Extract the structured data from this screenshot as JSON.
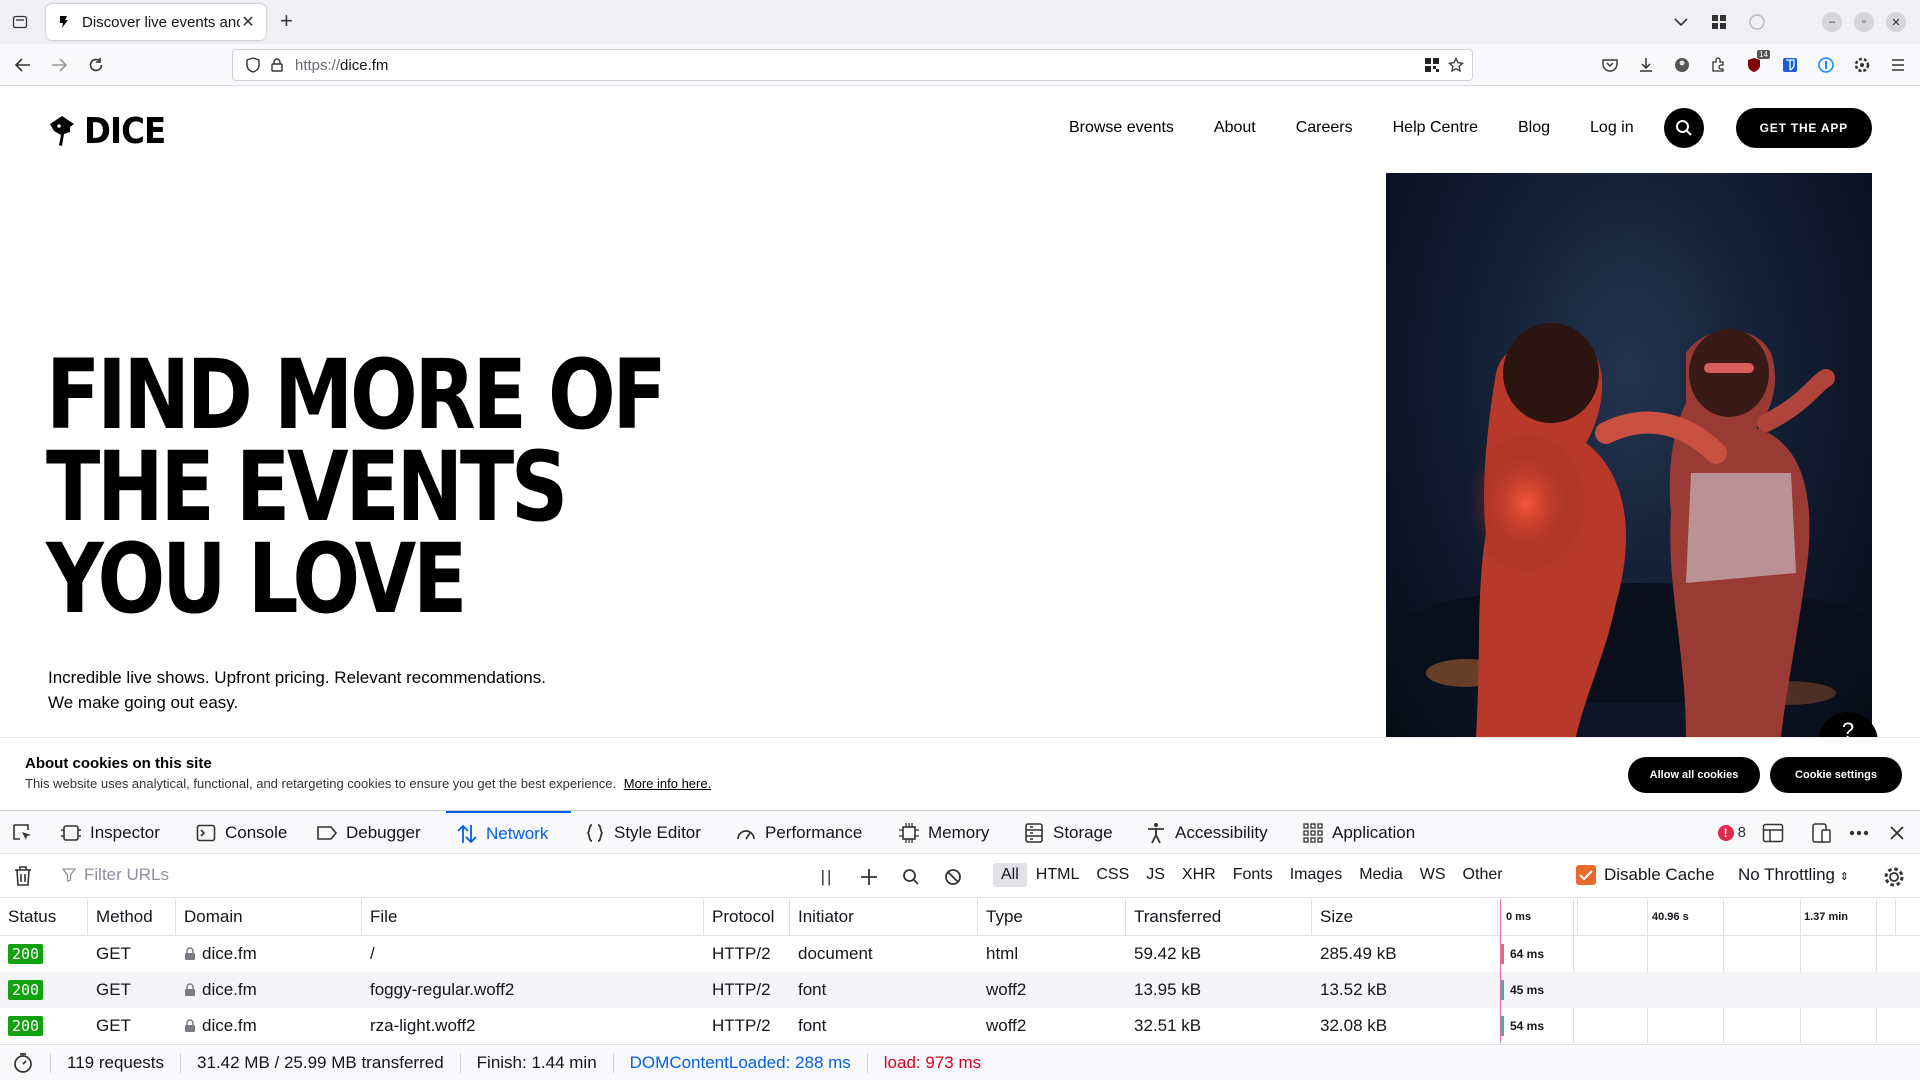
{
  "browser": {
    "tab_title": "Discover live events and",
    "url_scheme": "https://",
    "url_host": "dice.fm",
    "extension_badge": "14"
  },
  "site": {
    "logo_text": "DICE",
    "nav": [
      "Browse events",
      "About",
      "Careers",
      "Help Centre",
      "Blog",
      "Log in"
    ],
    "cta": "GET THE APP",
    "hero_lines": [
      "FIND MORE OF",
      "THE EVENTS",
      "YOU LOVE"
    ],
    "hero_sub_1": "Incredible live shows. Upfront pricing. Relevant recommendations.",
    "hero_sub_2": "We make going out easy.",
    "help_glyph": "?"
  },
  "cookie": {
    "title": "About cookies on this site",
    "desc": "This website uses analytical, functional, and retargeting cookies to ensure you get the best experience.",
    "more": "More info here.",
    "allow": "Allow all cookies",
    "settings": "Cookie settings"
  },
  "devtools": {
    "tabs": [
      "Inspector",
      "Console",
      "Debugger",
      "Network",
      "Style Editor",
      "Performance",
      "Memory",
      "Storage",
      "Accessibility",
      "Application"
    ],
    "active_tab": "Network",
    "error_count": "8",
    "filter_placeholder": "Filter URLs",
    "pause_glyph": "||",
    "type_filters": [
      "All",
      "HTML",
      "CSS",
      "JS",
      "XHR",
      "Fonts",
      "Images",
      "Media",
      "WS",
      "Other"
    ],
    "disable_cache": "Disable Cache",
    "throttling": "No Throttling",
    "columns": [
      "Status",
      "Method",
      "Domain",
      "File",
      "Protocol",
      "Initiator",
      "Type",
      "Transferred",
      "Size"
    ],
    "timeline_labels": [
      "0 ms",
      "40.96 s",
      "1.37 min"
    ],
    "rows": [
      {
        "status": "200",
        "method": "GET",
        "domain": "dice.fm",
        "file": "/",
        "protocol": "HTTP/2",
        "initiator": "document",
        "type": "html",
        "transferred": "59.42 kB",
        "size": "285.49 kB",
        "time": "64 ms",
        "color": "#e06c75"
      },
      {
        "status": "200",
        "method": "GET",
        "domain": "dice.fm",
        "file": "foggy-regular.woff2",
        "protocol": "HTTP/2",
        "initiator": "font",
        "type": "woff2",
        "transferred": "13.95 kB",
        "size": "13.52 kB",
        "time": "45 ms",
        "color": "#3fb0ac"
      },
      {
        "status": "200",
        "method": "GET",
        "domain": "dice.fm",
        "file": "rza-light.woff2",
        "protocol": "HTTP/2",
        "initiator": "font",
        "type": "woff2",
        "transferred": "32.51 kB",
        "size": "32.08 kB",
        "time": "54 ms",
        "color": "#3fb0ac"
      }
    ],
    "status": {
      "requests": "119 requests",
      "size": "31.42 MB / 25.99 MB transferred",
      "finish": "Finish: 1.44 min",
      "dcl": "DOMContentLoaded: 288 ms",
      "load": "load: 973 ms"
    }
  }
}
